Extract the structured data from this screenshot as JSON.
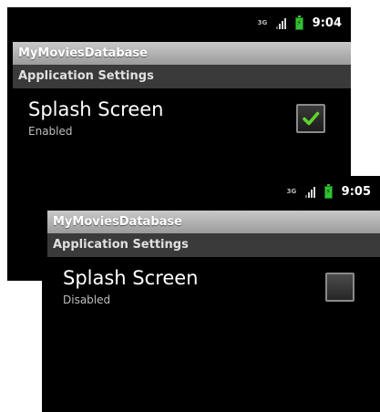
{
  "screens": [
    {
      "status_bar": {
        "network_label": "3G",
        "time": "9:04"
      },
      "app_title": "MyMoviesDatabase",
      "category_title": "Application Settings",
      "preference": {
        "title": "Splash Screen",
        "summary": "Enabled",
        "checked": true
      }
    },
    {
      "status_bar": {
        "network_label": "3G",
        "time": "9:05"
      },
      "app_title": "MyMoviesDatabase",
      "category_title": "Application Settings",
      "preference": {
        "title": "Splash Screen",
        "summary": "Disabled",
        "checked": false
      }
    }
  ],
  "icons": {
    "network": "network-3g-icon",
    "signal": "signal-strength-icon",
    "battery": "battery-charging-icon",
    "check": "checkmark-icon"
  },
  "colors": {
    "title_bar": "#b4b4b4",
    "category_bar": "#3a3a3a",
    "check_green": "#5fd42a",
    "battery_green": "#32c234"
  }
}
